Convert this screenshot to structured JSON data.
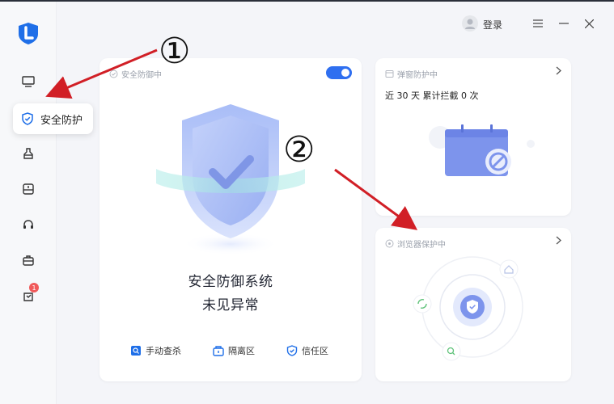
{
  "sidebar": {
    "active_label": "安全防护",
    "badge_count": "1",
    "items": [
      "screen-icon",
      "shield-icon",
      "broom-icon",
      "drive-icon",
      "headset-icon",
      "toolbox-icon",
      "bag-icon"
    ]
  },
  "titlebar": {
    "login_label": "登录"
  },
  "main_card": {
    "status": "安全防御中",
    "title": "安全防御系统",
    "subtitle": "未见异常",
    "actions": [
      {
        "label": "手动查杀"
      },
      {
        "label": "隔离区"
      },
      {
        "label": "信任区"
      }
    ]
  },
  "popup_card": {
    "status": "弹窗防护中",
    "count_text": "近 30 天 累计拦截 0 次"
  },
  "browser_card": {
    "status": "浏览器保护中"
  },
  "annotations": {
    "marker1": "①",
    "marker2": "②"
  },
  "colors": {
    "accent": "#2f6ff0",
    "annotation_red": "#d11f26",
    "badge": "#f05a5a"
  }
}
